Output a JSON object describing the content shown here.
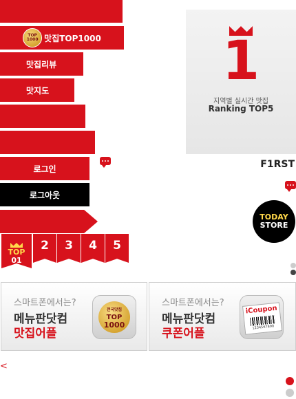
{
  "menu": {
    "top1000_badge": "전국맛집 TOP 1000",
    "top1000_label": "맛집TOP1000",
    "review_label": "맛집리뷰",
    "map_label": "맛지도",
    "login_label": "로그인",
    "logout_label": "로그아웃"
  },
  "ranking_panel": {
    "number": "1",
    "subtitle": "지역별 실시간 맛집",
    "title": "Ranking TOP5"
  },
  "brand": {
    "logo": "F1RST"
  },
  "today_store": {
    "line1": "TODAY",
    "line2": "STORE"
  },
  "rank_tabs": {
    "first_top": "TOP",
    "first_num": "01",
    "items": [
      "2",
      "3",
      "4",
      "5"
    ]
  },
  "banners": [
    {
      "line1": "스마트폰에서는?",
      "line2": "메뉴판닷컴",
      "line3": "맛집어플",
      "badge_top": "전국맛집",
      "badge_main": "TOP",
      "badge_num": "1000"
    },
    {
      "line1": "스마트폰에서는?",
      "line2": "메뉴판닷컴",
      "line3": "쿠폰어플",
      "badge_text": "iCoupon",
      "badge_sub": "1234567890"
    }
  ],
  "nav": {
    "prev": "<"
  },
  "colors": {
    "accent": "#d7121c",
    "dark": "#000000"
  }
}
